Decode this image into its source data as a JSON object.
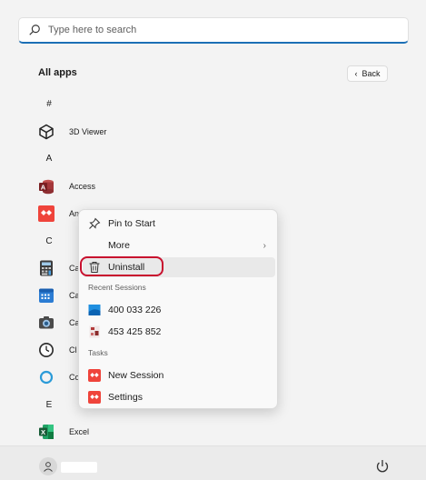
{
  "search": {
    "placeholder": "Type here to search"
  },
  "all_apps": {
    "title": "All apps",
    "back_label": "Back"
  },
  "apps": {
    "letter_hash": "#",
    "viewer_3d": "3D Viewer",
    "letter_a": "A",
    "access": "Access",
    "anydesk_partial": "An",
    "letter_c": "C",
    "calc_partial": "Ca",
    "calendar_partial": "Ca",
    "camera_partial": "Ca",
    "clock_partial": "Cl",
    "cortana_partial": "Co",
    "letter_e": "E",
    "excel": "Excel"
  },
  "context_menu": {
    "pin_to_start": "Pin to Start",
    "more": "More",
    "uninstall": "Uninstall",
    "recent_sessions_header": "Recent Sessions",
    "session_1": "400 033 226",
    "session_2": "453 425 852",
    "tasks_header": "Tasks",
    "new_session": "New Session",
    "settings": "Settings"
  },
  "colors": {
    "accent": "#1b6fb5",
    "highlight_ring": "#c8102e",
    "anydesk_red": "#ef443b",
    "access_red": "#a4373a",
    "excel_green": "#1d6f42"
  }
}
